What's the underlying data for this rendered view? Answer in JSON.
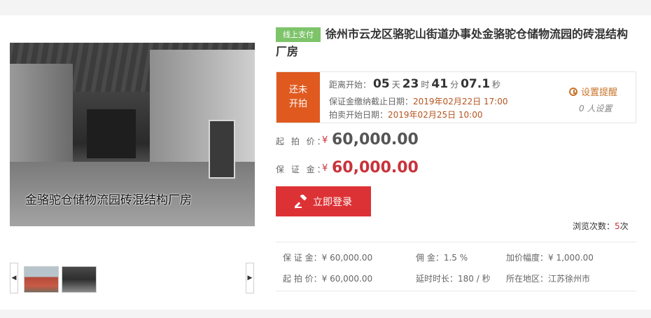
{
  "title": {
    "badge": "线上支付",
    "line1": "徐州市云龙区骆驼山街道办事处金骆驼仓储物流园的砖混结构",
    "line2": "厂房"
  },
  "photo": {
    "caption": "金骆驼仓储物流园砖混结构厂房"
  },
  "countdown": {
    "status_line1": "还未",
    "status_line2": "开拍",
    "prefix": "距离开始：",
    "days": "05",
    "days_unit": "天",
    "hours": "23",
    "hours_unit": "时",
    "minutes": "41",
    "minutes_unit": "分",
    "seconds": "07.1",
    "seconds_unit": "秒",
    "deposit_deadline_label": "保证金缴纳截止日期：",
    "deposit_deadline": "2019年02月22日 17:00",
    "start_label": "拍卖开始日期：",
    "start_date": "2019年02月25日 10:00",
    "remind_label": "设置提醒",
    "remind_count": "0 人设置"
  },
  "prices": {
    "start_label": "起 拍 价：",
    "start_currency": "¥",
    "start_value": "60,000.00",
    "deposit_label": "保 证 金：",
    "deposit_currency": "¥",
    "deposit_value": "60,000.00"
  },
  "login_button": "立即登录",
  "views": {
    "label": "浏览次数：",
    "count": "5",
    "unit": "次"
  },
  "info": {
    "deposit": "保  证  金：¥ 60,000.00",
    "commission": "佣        金：1.5 %",
    "increment": "加价幅度：¥ 1,000.00",
    "start_price": "起  拍  价：¥ 60,000.00",
    "delay": "延时时长：180 / 秒",
    "region": "所在地区：江苏徐州市"
  },
  "thumb_nav": {
    "prev": "◀",
    "next": "▶"
  },
  "colors": {
    "status_bg": "#e05a1f",
    "badge_bg": "#7dc36a",
    "button_bg": "#dd3235",
    "price_red": "#c8323b"
  }
}
